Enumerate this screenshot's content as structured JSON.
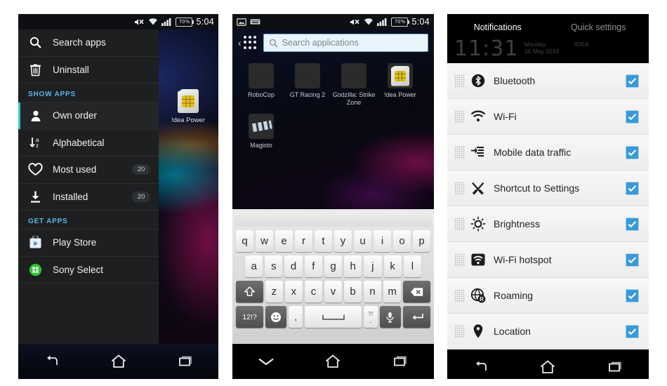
{
  "statusbar": {
    "time": "5:04",
    "battery": "70%",
    "icons": [
      "mute-icon",
      "wifi-icon",
      "signal-icon",
      "battery-icon"
    ]
  },
  "panel1": {
    "menu": [
      {
        "label": "Search apps",
        "icon": "search-icon",
        "badge": "",
        "selected": false,
        "header": false
      },
      {
        "label": "Uninstall",
        "icon": "trash-icon",
        "badge": "",
        "selected": false,
        "header": false
      },
      {
        "label": "SHOW APPS",
        "icon": "",
        "badge": "",
        "selected": false,
        "header": true
      },
      {
        "label": "Own order",
        "icon": "person-icon",
        "badge": "",
        "selected": true,
        "header": false
      },
      {
        "label": "Alphabetical",
        "icon": "sort-alpha-icon",
        "badge": "",
        "selected": false,
        "header": false
      },
      {
        "label": "Most used",
        "icon": "heart-icon",
        "badge": "20",
        "selected": false,
        "header": false
      },
      {
        "label": "Installed",
        "icon": "download-icon",
        "badge": "20",
        "selected": false,
        "header": false
      },
      {
        "label": "GET APPS",
        "icon": "",
        "badge": "",
        "selected": false,
        "header": true
      },
      {
        "label": "Play Store",
        "icon": "play-store-icon",
        "badge": "",
        "selected": false,
        "header": false
      },
      {
        "label": "Sony Select",
        "icon": "sony-select-icon",
        "badge": "",
        "selected": false,
        "header": false
      }
    ],
    "app": {
      "name": "!dea Power",
      "icon": "sim-card-icon"
    },
    "nav": [
      "back-icon",
      "home-icon",
      "recents-icon"
    ]
  },
  "panel2": {
    "statusbar_left": [
      "screenshot-icon",
      "keyboard-icon"
    ],
    "search": {
      "placeholder": "Search applications",
      "icon": "search-icon"
    },
    "apps_grid_icon": "app-grid-icon",
    "back_chevron": "chevron-left-icon",
    "apps": [
      {
        "name": "RoboCop",
        "thumb": "th-robocop"
      },
      {
        "name": "GT Racing 2",
        "thumb": "th-gt"
      },
      {
        "name": "Godzilla: Strike Zone",
        "thumb": "th-godzilla"
      },
      {
        "name": "!dea Power",
        "thumb": "th-sim"
      },
      {
        "name": "Magisto",
        "thumb": "th-magisto"
      }
    ],
    "keyboard": {
      "row1": [
        "q",
        "w",
        "e",
        "r",
        "t",
        "y",
        "u",
        "i",
        "o",
        "p"
      ],
      "row2": [
        "a",
        "s",
        "d",
        "f",
        "g",
        "h",
        "j",
        "k",
        "l"
      ],
      "row3": [
        "z",
        "x",
        "c",
        "v",
        "b",
        "n",
        "m"
      ],
      "shift": "shift-icon",
      "backspace": "backspace-icon",
      "numbers": "12!?",
      "emoji": "emoji-icon",
      "comma": ",",
      "space": "space-icon",
      "period_upper": "?!",
      "period_lower": ".",
      "mic": "mic-icon",
      "enter": "enter-icon"
    },
    "nav": [
      "collapse-keyboard-icon",
      "home-icon",
      "recents-icon"
    ]
  },
  "panel3": {
    "tabs": [
      {
        "label": "Notifications",
        "active": true
      },
      {
        "label": "Quick settings",
        "active": false
      }
    ],
    "clock": {
      "time": "11:31",
      "day": "Monday",
      "date": "26 May 2014",
      "carrier": "!IDEA"
    },
    "accent_color": "#3a99d8",
    "rows": [
      {
        "label": "Bluetooth",
        "icon": "bluetooth-icon",
        "checked": true
      },
      {
        "label": "Wi-Fi",
        "icon": "wifi-icon",
        "checked": true
      },
      {
        "label": "Mobile data traffic",
        "icon": "mobile-data-icon",
        "checked": true
      },
      {
        "label": "Shortcut to Settings",
        "icon": "tools-icon",
        "checked": true
      },
      {
        "label": "Brightness",
        "icon": "brightness-icon",
        "checked": true
      },
      {
        "label": "Wi-Fi hotspot",
        "icon": "hotspot-icon",
        "checked": true
      },
      {
        "label": "Roaming",
        "icon": "roaming-icon",
        "checked": true
      },
      {
        "label": "Location",
        "icon": "location-pin-icon",
        "checked": true
      }
    ],
    "nav": [
      "back-icon",
      "home-icon",
      "recents-icon"
    ]
  }
}
